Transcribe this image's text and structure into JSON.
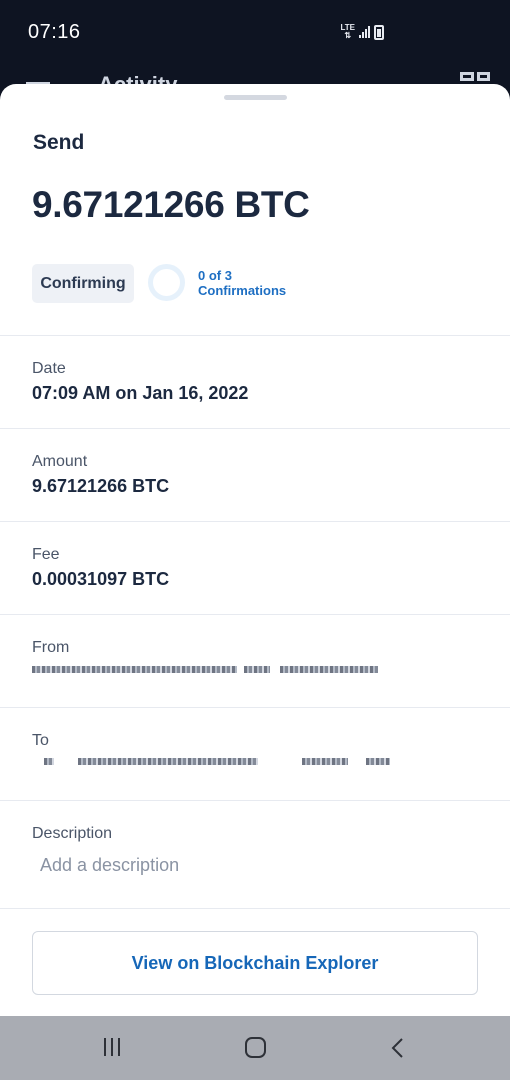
{
  "status_bar": {
    "time": "07:16",
    "network": "LTE"
  },
  "app_bar": {
    "title": "Activity"
  },
  "transaction": {
    "type": "Send",
    "amount_display": "9.67121266 BTC",
    "status": "Confirming",
    "confirmations_line1": "0 of 3",
    "confirmations_line2": "Confirmations",
    "confirmations_done": 0,
    "confirmations_required": 3
  },
  "details": {
    "date_label": "Date",
    "date_value": "07:09 AM on Jan 16, 2022",
    "amount_label": "Amount",
    "amount_value": "9.67121266 BTC",
    "fee_label": "Fee",
    "fee_value": "0.00031097 BTC",
    "from_label": "From",
    "to_label": "To",
    "description_label": "Description",
    "description_placeholder": "Add a description"
  },
  "actions": {
    "explorer_label": "View on Blockchain Explorer"
  },
  "colors": {
    "accent": "#1667b8",
    "confirm_text": "#1e6fc3",
    "background_dark": "#0e1422"
  },
  "icons": {
    "status": [
      "lte-icon",
      "signal-icon",
      "battery-charging-icon"
    ],
    "app_bar": [
      "menu-icon",
      "qr-code-icon"
    ],
    "nav": [
      "recents-icon",
      "home-icon",
      "back-icon"
    ]
  }
}
